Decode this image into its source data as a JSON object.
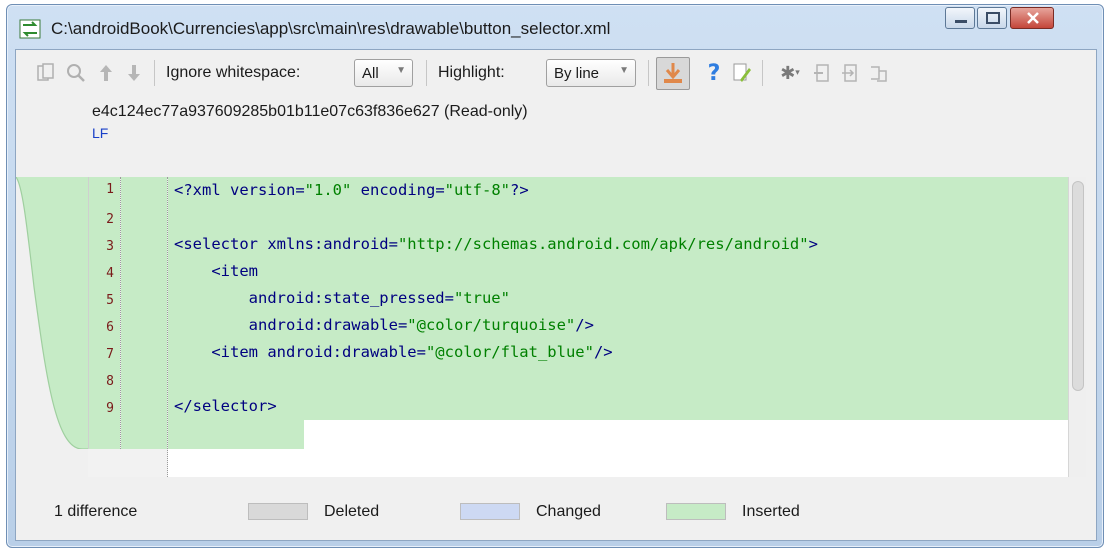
{
  "window": {
    "title": "C:\\androidBook\\Currencies\\app\\src\\main\\res\\drawable\\button_selector.xml"
  },
  "toolbar": {
    "ignore_whitespace_label": "Ignore whitespace:",
    "ignore_whitespace_value": "All",
    "highlight_label": "Highlight:",
    "highlight_value": "By line"
  },
  "file_info": {
    "revision": "e4c124ec77a937609285b01b11e07c63f836e627 (Read-only)",
    "line_ending": "LF"
  },
  "code_lines": [
    {
      "num": "1",
      "text": "<?xml version=\"1.0\" encoding=\"utf-8\"?>"
    },
    {
      "num": "2",
      "text": ""
    },
    {
      "num": "3",
      "text": "<selector xmlns:android=\"http://schemas.android.com/apk/res/android\">"
    },
    {
      "num": "4",
      "text": "    <item"
    },
    {
      "num": "5",
      "text": "        android:state_pressed=\"true\""
    },
    {
      "num": "6",
      "text": "        android:drawable=\"@color/turquoise\"/>"
    },
    {
      "num": "7",
      "text": "    <item android:drawable=\"@color/flat_blue\"/>"
    },
    {
      "num": "8",
      "text": ""
    },
    {
      "num": "9",
      "text": "</selector>"
    }
  ],
  "status": {
    "difference_count": "1 difference",
    "legend_deleted": "Deleted",
    "legend_changed": "Changed",
    "legend_inserted": "Inserted"
  },
  "colors": {
    "inserted": "#c6ebc6",
    "changed": "#cdd9f3",
    "deleted": "#d9d9d9",
    "line_number": "#7a1a1a"
  },
  "icons": [
    "copy-icon",
    "find-icon",
    "previous-diff-icon",
    "next-diff-icon",
    "apply-change-icon",
    "help-icon",
    "edit-icon",
    "settings-icon",
    "collapse-icon",
    "expand-icon",
    "sync-icon"
  ]
}
